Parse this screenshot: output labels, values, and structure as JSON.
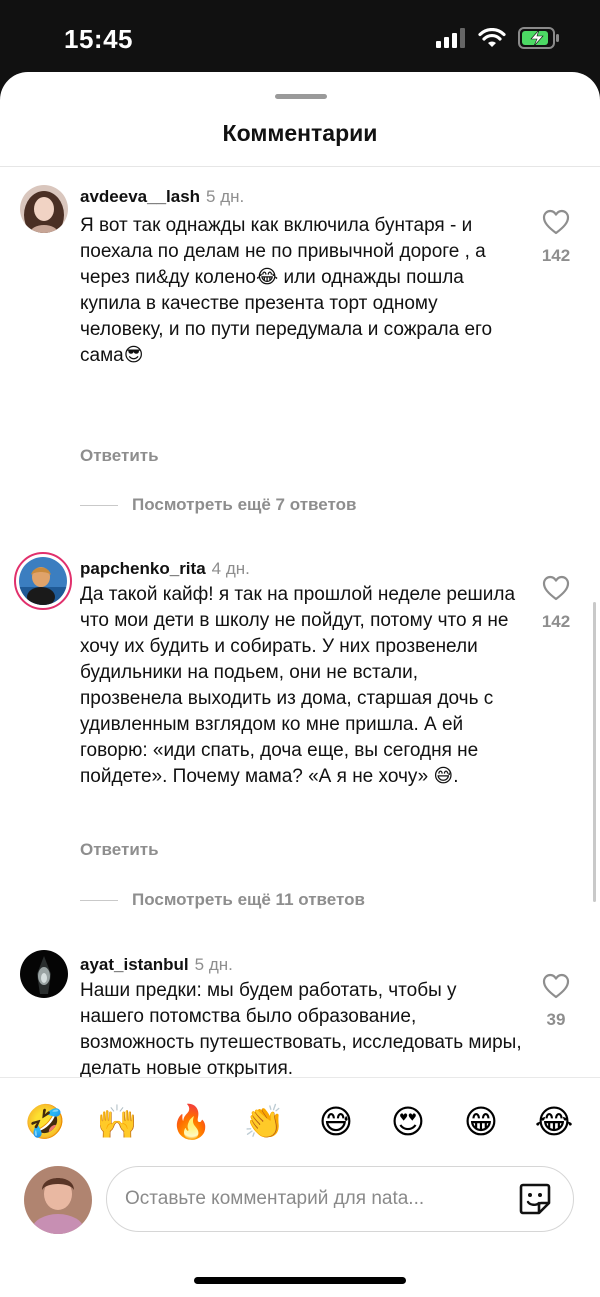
{
  "status": {
    "time": "15:45"
  },
  "sheet": {
    "title": "Комментарии"
  },
  "comments": [
    {
      "username": "avdeeva__lash",
      "time_ago": "5 дн.",
      "text": "Я вот так однажды как включила бунтаря - и поехала по делам не по привычной дороге , а через пи&ду колено😂 или однажды пошла купила в качестве презента торт одному человеку, и по пути передумала и сожрала его сама😎",
      "likes": "142",
      "reply_label": "Ответить",
      "view_more": "Посмотреть ещё 7 ответов"
    },
    {
      "username": "papchenko_rita",
      "time_ago": "4 дн.",
      "text": "Да такой кайф! я так на прошлой неделе решила что мои дети в школу не пойдут, потому что я не хочу их будить и собирать. У них прозвенели будильники на подьем, они не встали, прозвенела выходить из дома, старшая дочь с удивленным взглядом ко мне пришла. А ей говорю: «иди спать, доча еще, вы сегодня не пойдете». Почему мама? «А я не хочу» 😅.",
      "likes": "142",
      "reply_label": "Ответить",
      "view_more": "Посмотреть ещё 11 ответов"
    },
    {
      "username": "ayat_istanbul",
      "time_ago": "5 дн.",
      "text": "Наши предки: мы будем работать, чтобы у нашего потомства было образование, возможность путешествовать, исследовать миры, делать новые открытия.\n...\nМы: ура, я взрослый! Самое время",
      "likes": "39"
    }
  ],
  "emoji_bar": [
    "🤣",
    "🙌",
    "🔥",
    "👏",
    "😅",
    "😍",
    "😁",
    "😂"
  ],
  "composer": {
    "placeholder": "Оставьте комментарий для nata..."
  },
  "icons": {
    "like": "heart-outline-icon",
    "sticker": "sticker-icon",
    "signal": "signal-icon",
    "wifi": "wifi-icon",
    "battery": "battery-charging-icon"
  },
  "colors": {
    "battery": "#4cd964",
    "story_ring": "#e1306c"
  }
}
